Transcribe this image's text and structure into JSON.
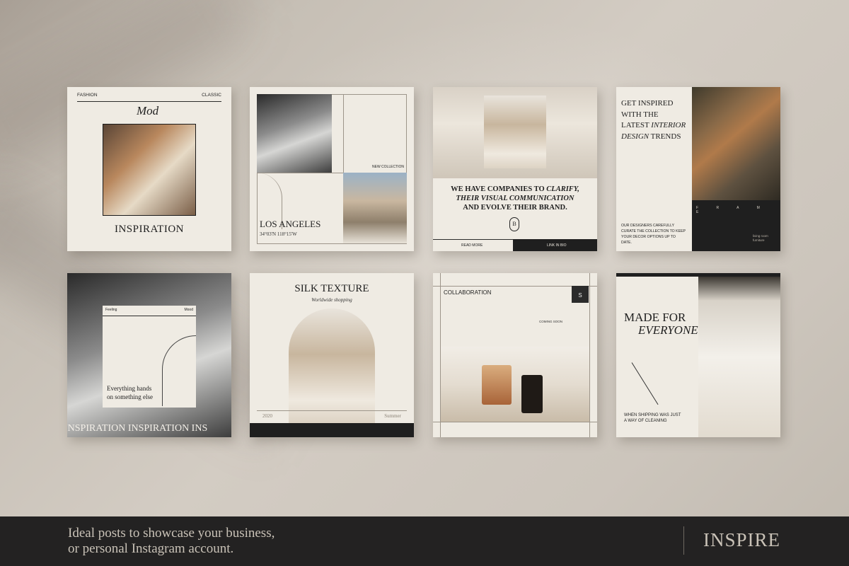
{
  "cards": {
    "c1": {
      "left": "FASHION",
      "right": "CLASSIC",
      "script": "Mod",
      "title": "INSPIRATION"
    },
    "c2": {
      "tag": "NEW COLLECTION",
      "title": "LOS ANGELES",
      "coords": "34°03'N 118°15'W"
    },
    "c3": {
      "line1": "WE HAVE COMPANIES TO ",
      "line1_em": "CLARIFY,",
      "line2": "THEIR VISUAL COMMUNICATION",
      "line3": "AND EVOLVE THEIR BRAND.",
      "monogram": "B",
      "btn_left": "READ MORE",
      "btn_right": "LINK IN BIO"
    },
    "c4": {
      "l1": "GET INSPIRED",
      "l2": "WITH THE",
      "l3a": "LATEST ",
      "l3b": "INTERIOR",
      "l4a": "DESIGN",
      "l4b": " TRENDS",
      "brand": "F R A M E",
      "body": "OUR DESIGNERS CAREFULLY CURATE THE COLLECTION TO KEEP YOUR DECOR OPTIONS UP TO DATE.",
      "side": "living room furniture"
    },
    "c5": {
      "left": "Feeling",
      "right": "Mood",
      "text1": "Everything hands",
      "text2": "on something else",
      "marquee": "INSPIRATION INSPIRATION INS"
    },
    "c6": {
      "title": "SILK TEXTURE",
      "script": "Worldwide shopping",
      "year": "2020",
      "season": "Summer"
    },
    "c7": {
      "title": "COLLABORATION",
      "badge": "S",
      "tag": "COMING SOON"
    },
    "c8": {
      "l1": "MADE FOR",
      "l2": "EVERYONE",
      "foot1": "WHEN SHIPPING WAS JUST",
      "foot2": "A WAY OF CLEANING"
    }
  },
  "footer": {
    "line1": "Ideal posts to showcase your business,",
    "line2": "or personal Instagram account.",
    "brand": "INSPIRE"
  },
  "colors": {
    "paper": "#efebe3",
    "ink": "#1f1f1f",
    "footer": "#232222",
    "footer_text": "#c9c2b7"
  }
}
